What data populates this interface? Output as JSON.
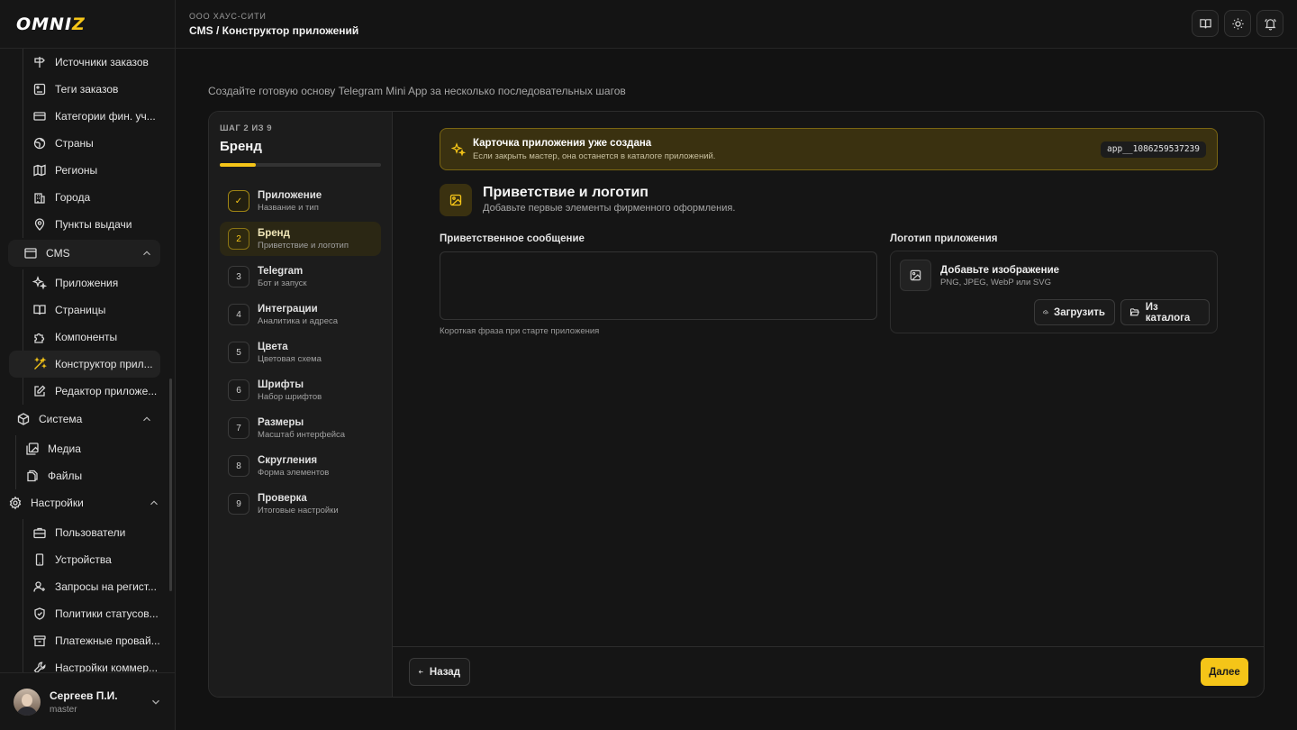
{
  "brand": {
    "logo_main": "OMNI",
    "logo_accent": "Z"
  },
  "sidebar": {
    "top_items": [
      {
        "label": "Источники заказов",
        "icon": "signpost-icon"
      },
      {
        "label": "Теги заказов",
        "icon": "tag-icon"
      },
      {
        "label": "Категории фин. уч...",
        "icon": "card-icon"
      },
      {
        "label": "Страны",
        "icon": "globe-icon"
      },
      {
        "label": "Регионы",
        "icon": "map-icon"
      },
      {
        "label": "Города",
        "icon": "building-icon"
      },
      {
        "label": "Пункты выдачи",
        "icon": "pin-icon"
      }
    ],
    "cms_group": {
      "label": "CMS",
      "icon": "window-icon"
    },
    "cms_items": [
      {
        "label": "Приложения",
        "icon": "sparkles-icon"
      },
      {
        "label": "Страницы",
        "icon": "book-icon"
      },
      {
        "label": "Компоненты",
        "icon": "puzzle-icon"
      },
      {
        "label": "Конструктор прил...",
        "icon": "wand-icon"
      },
      {
        "label": "Редактор приложе...",
        "icon": "edit-icon"
      }
    ],
    "system_group": {
      "label": "Система",
      "icon": "cube-icon"
    },
    "system_items": [
      {
        "label": "Медиа",
        "icon": "images-icon"
      },
      {
        "label": "Файлы",
        "icon": "files-icon"
      }
    ],
    "settings_group": {
      "label": "Настройки",
      "icon": "gear-icon"
    },
    "settings_items": [
      {
        "label": "Пользователи",
        "icon": "users-icon"
      },
      {
        "label": "Устройства",
        "icon": "device-icon"
      },
      {
        "label": "Запросы на регист...",
        "icon": "user-plus-icon"
      },
      {
        "label": "Политики статусов...",
        "icon": "shield-icon"
      },
      {
        "label": "Платежные провай...",
        "icon": "archive-icon"
      },
      {
        "label": "Настройки коммер...",
        "icon": "wrench-icon"
      }
    ]
  },
  "user": {
    "name": "Сергеев П.И.",
    "role": "master"
  },
  "header": {
    "org": "ООО ХАУС-СИТИ",
    "breadcrumb": "CMS / Конструктор приложений"
  },
  "intro": "Создайте готовую основу Telegram Mini App за несколько последовательных шагов",
  "wizard": {
    "step_counter": "ШАГ 2 ИЗ 9",
    "current_title": "Бренд",
    "progress": 0.222,
    "steps": [
      {
        "num": "✓",
        "title": "Приложение",
        "desc": "Название и тип",
        "state": "done"
      },
      {
        "num": "2",
        "title": "Бренд",
        "desc": "Приветствие и логотип",
        "state": "current"
      },
      {
        "num": "3",
        "title": "Telegram",
        "desc": "Бот и запуск",
        "state": "todo"
      },
      {
        "num": "4",
        "title": "Интеграции",
        "desc": "Аналитика и адреса",
        "state": "todo"
      },
      {
        "num": "5",
        "title": "Цвета",
        "desc": "Цветовая схема",
        "state": "todo"
      },
      {
        "num": "6",
        "title": "Шрифты",
        "desc": "Набор шрифтов",
        "state": "todo"
      },
      {
        "num": "7",
        "title": "Размеры",
        "desc": "Масштаб интерфейса",
        "state": "todo"
      },
      {
        "num": "8",
        "title": "Скругления",
        "desc": "Форма элементов",
        "state": "todo"
      },
      {
        "num": "9",
        "title": "Проверка",
        "desc": "Итоговые настройки",
        "state": "todo"
      }
    ],
    "banner": {
      "title": "Карточка приложения уже создана",
      "desc": "Если закрыть мастер, она останется в каталоге приложений.",
      "code": "app__1086259537239"
    },
    "section": {
      "title": "Приветствие и логотип",
      "desc": "Добавьте первые элементы фирменного оформления."
    },
    "greeting": {
      "label": "Приветственное сообщение",
      "value": "",
      "hint": "Короткая фраза при старте приложения"
    },
    "logo": {
      "label": "Логотип приложения",
      "title": "Добавьте изображение",
      "formats": "PNG, JPEG, WebP или SVG",
      "upload_label": "Загрузить",
      "catalog_label": "Из каталога"
    },
    "back_label": "Назад",
    "next_label": "Далее"
  },
  "colors": {
    "accent": "#f5c518"
  }
}
